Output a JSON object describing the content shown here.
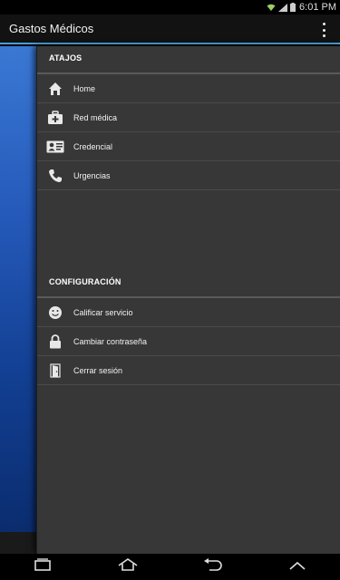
{
  "status_bar": {
    "time": "6:01 PM"
  },
  "action_bar": {
    "title": "Gastos Médicos"
  },
  "drawer": {
    "shortcuts_header": "ATAJOS",
    "shortcuts": [
      {
        "label": "Home",
        "icon": "home-icon"
      },
      {
        "label": "Red médica",
        "icon": "medical-kit-icon"
      },
      {
        "label": "Credencial",
        "icon": "id-card-icon"
      },
      {
        "label": "Urgencias",
        "icon": "phone-icon"
      }
    ],
    "settings_header": "CONFIGURACIÓN",
    "settings": [
      {
        "label": "Calificar servicio",
        "icon": "smiley-icon"
      },
      {
        "label": "Cambiar contraseña",
        "icon": "lock-icon"
      },
      {
        "label": "Cerrar sesión",
        "icon": "door-icon"
      }
    ]
  },
  "colors": {
    "accent": "#4a9fd8",
    "drawer_bg": "#373737",
    "content_blue": "#2458b8"
  }
}
